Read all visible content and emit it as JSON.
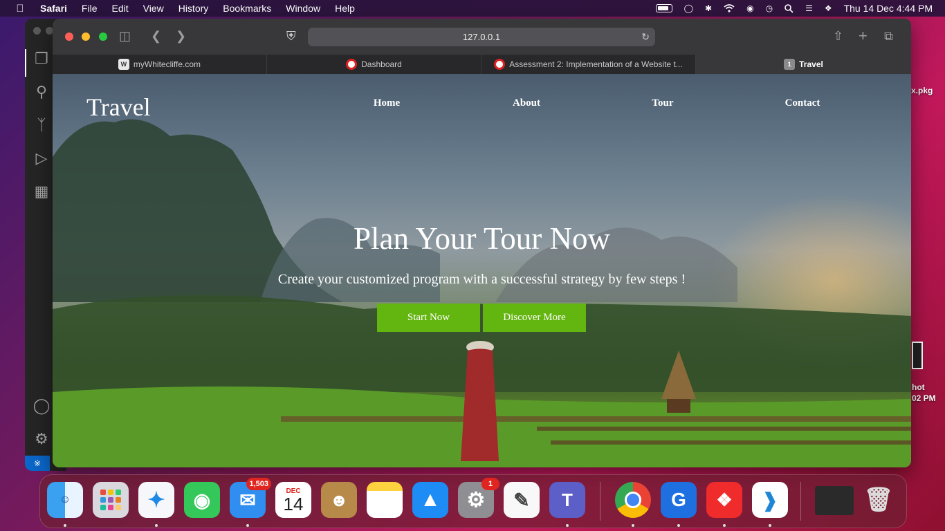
{
  "menubar": {
    "app_name": "Safari",
    "menus": [
      "File",
      "Edit",
      "View",
      "History",
      "Bookmarks",
      "Window",
      "Help"
    ],
    "clock": "Thu 14 Dec  4:44 PM"
  },
  "desktop": {
    "file_label": "x.pkg",
    "screenshot_label_1": "hot",
    "screenshot_label_2": "02 PM"
  },
  "browser": {
    "address": "127.0.0.1",
    "tabs": [
      {
        "title": "myWhitecliffe.com",
        "favicon": "W"
      },
      {
        "title": "Dashboard",
        "favicon": ""
      },
      {
        "title": "Assessment 2: Implementation of a Website t...",
        "favicon": ""
      },
      {
        "title": "Travel",
        "favicon": "1"
      }
    ]
  },
  "page": {
    "brand": "Travel",
    "nav": [
      "Home",
      "About",
      "Tour",
      "Contact"
    ],
    "hero_title": "Plan Your Tour Now",
    "hero_subtitle": "Create your customized program with a successful strategy by few steps !",
    "primary_button": "Start Now",
    "secondary_button": "Discover More",
    "button_color": "#63b50f"
  },
  "dock": {
    "mail_badge": "1,503",
    "calendar_month": "DEC",
    "calendar_day": "14",
    "settings_badge": "1"
  }
}
